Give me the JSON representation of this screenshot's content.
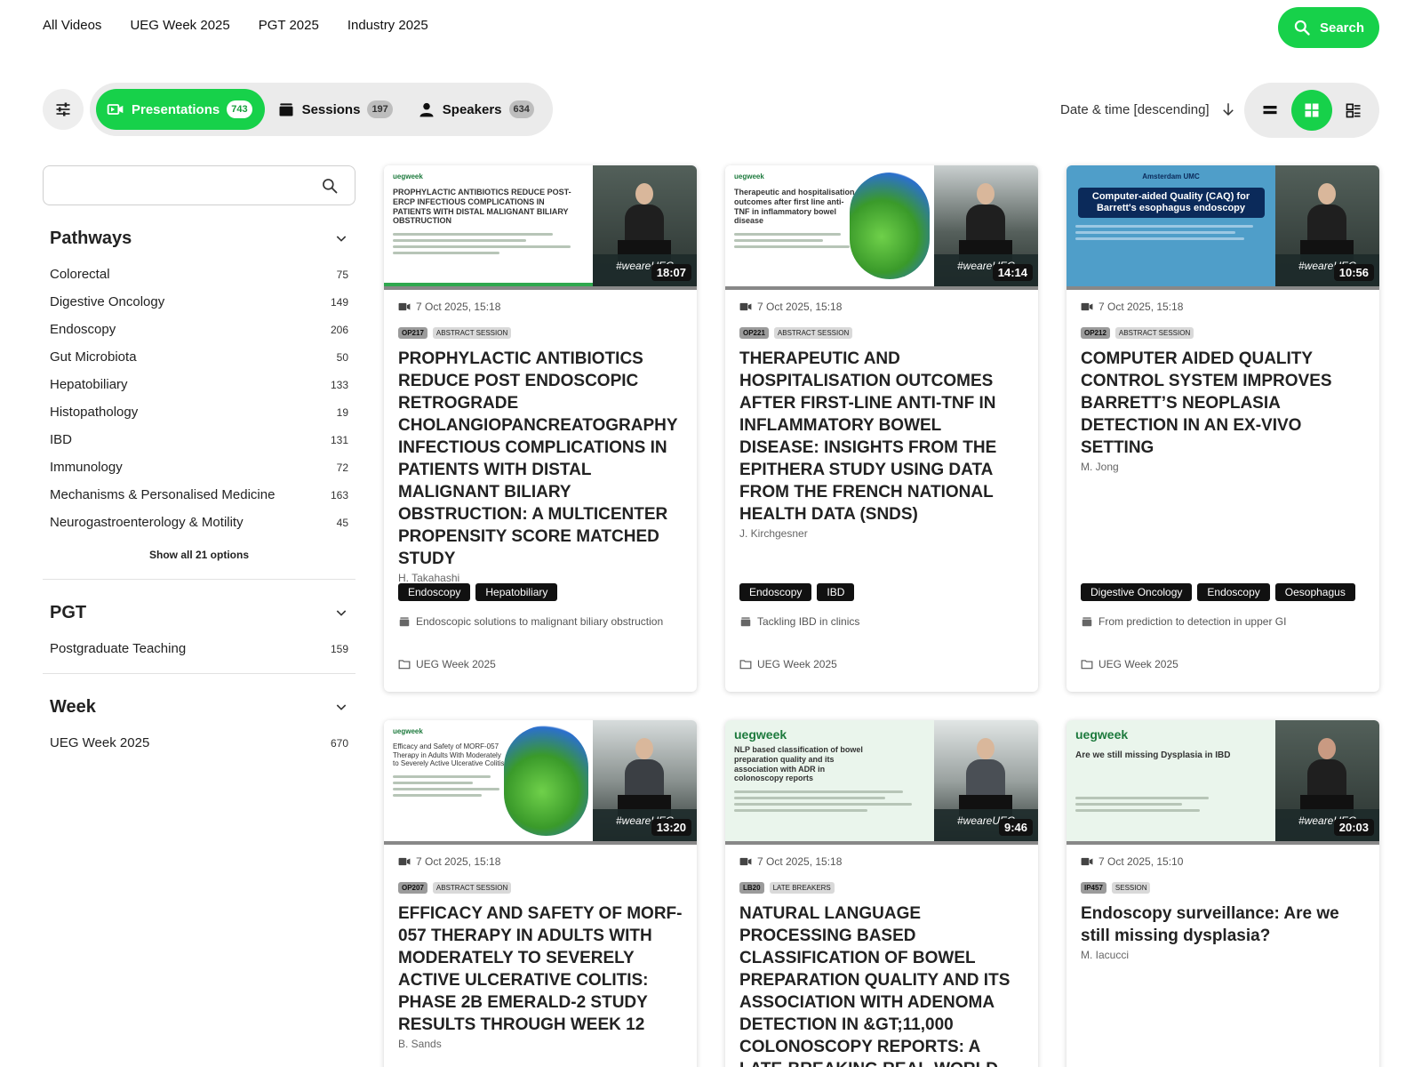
{
  "nav": {
    "links": [
      "All Videos",
      "UEG Week 2025",
      "PGT 2025",
      "Industry 2025"
    ],
    "search_label": "Search"
  },
  "tabs": [
    {
      "label": "Presentations",
      "count": "743",
      "icon": "video-icon"
    },
    {
      "label": "Sessions",
      "count": "197",
      "icon": "briefcase-icon"
    },
    {
      "label": "Speakers",
      "count": "634",
      "icon": "person-icon"
    }
  ],
  "sort": {
    "label": "Date & time [descending]"
  },
  "sidebar": {
    "search_placeholder": "",
    "facets": [
      {
        "title": "Pathways",
        "items": [
          {
            "label": "Colorectal",
            "count": "75"
          },
          {
            "label": "Digestive Oncology",
            "count": "149"
          },
          {
            "label": "Endoscopy",
            "count": "206"
          },
          {
            "label": "Gut Microbiota",
            "count": "50"
          },
          {
            "label": "Hepatobiliary",
            "count": "133"
          },
          {
            "label": "Histopathology",
            "count": "19"
          },
          {
            "label": "IBD",
            "count": "131"
          },
          {
            "label": "Immunology",
            "count": "72"
          },
          {
            "label": "Mechanisms & Personalised Medicine",
            "count": "163"
          },
          {
            "label": "Neurogastroenterology & Motility",
            "count": "45"
          }
        ],
        "show_all": "Show all 21 options"
      },
      {
        "title": "PGT",
        "items": [
          {
            "label": "Postgraduate Teaching",
            "count": "159"
          }
        ]
      },
      {
        "title": "Week",
        "items": [
          {
            "label": "UEG Week 2025",
            "count": "670"
          }
        ]
      }
    ]
  },
  "cards": [
    {
      "duration": "18:07",
      "slide_title": "PROPHYLACTIC ANTIBIOTICS REDUCE POST-ERCP INFECTIOUS COMPLICATIONS IN PATIENTS WITH DISTAL MALIGNANT BILIARY OBSTRUCTION",
      "slide_brand": "uegweek",
      "cam_tag": "#weareUEG",
      "date": "7 Oct 2025, 15:18",
      "code": "OP217",
      "type": "ABSTRACT SESSION",
      "title": "PROPHYLACTIC ANTIBIOTICS REDUCE POST ENDOSCOPIC RETROGRADE CHOLANGIOPANCREATOGRAPHY INFECTIOUS COMPLICATIONS IN PATIENTS WITH DISTAL MALIGNANT BILIARY OBSTRUCTION: A MULTICENTER PROPENSITY SCORE MATCHED STUDY",
      "speaker": "H. Takahashi",
      "topics": [
        "Endoscopy",
        "Hepatobiliary"
      ],
      "session": "Endoscopic solutions to malignant biliary obstruction",
      "event": "UEG Week 2025"
    },
    {
      "duration": "14:14",
      "slide_title": "Therapeutic and hospitalisation outcomes after first line anti-TNF in inflammatory bowel disease",
      "slide_brand": "uegweek",
      "cam_tag": "#weareUEG",
      "date": "7 Oct 2025, 15:18",
      "code": "OP221",
      "type": "ABSTRACT SESSION",
      "title": "THERAPEUTIC AND HOSPITALISATION OUTCOMES AFTER FIRST-LINE ANTI-TNF IN INFLAMMATORY BOWEL DISEASE: INSIGHTS FROM THE EPITHERA STUDY USING DATA FROM THE FRENCH NATIONAL HEALTH DATA (SNDS)",
      "speaker": "J. Kirchgesner",
      "topics": [
        "Endoscopy",
        "IBD"
      ],
      "session": "Tackling IBD in clinics",
      "event": "UEG Week 2025"
    },
    {
      "duration": "10:56",
      "slide_title": "Computer-aided Quality (CAQ) for Barrett's esophagus endoscopy",
      "slide_brand": "Amsterdam UMC",
      "cam_tag": "#weareUEG",
      "date": "7 Oct 2025, 15:18",
      "code": "OP212",
      "type": "ABSTRACT SESSION",
      "title": "COMPUTER AIDED QUALITY CONTROL SYSTEM IMPROVES BARRETT’S NEOPLASIA DETECTION IN AN EX-VIVO SETTING",
      "speaker": "M. Jong",
      "topics": [
        "Digestive Oncology",
        "Endoscopy",
        "Oesophagus"
      ],
      "session": "From prediction to detection in upper GI",
      "event": "UEG Week 2025"
    },
    {
      "duration": "13:20",
      "slide_title": "Efficacy and Safety of MORF-057 Therapy in Adults With Moderately to Severely Active Ulcerative Colitis",
      "slide_brand": "uegweek",
      "cam_tag": "#weareUEG",
      "date": "7 Oct 2025, 15:18",
      "code": "OP207",
      "type": "ABSTRACT SESSION",
      "title": "EFFICACY AND SAFETY OF MORF-057 THERAPY IN ADULTS WITH MODERATELY TO SEVERELY ACTIVE ULCERATIVE COLITIS: PHASE 2B EMERALD-2 STUDY RESULTS THROUGH WEEK 12",
      "speaker": "B. Sands",
      "topics": [],
      "session": "",
      "event": ""
    },
    {
      "duration": "9:46",
      "slide_title": "NLP based classification of bowel preparation quality and its association with ADR in colonoscopy reports",
      "slide_brand": "uegweek",
      "cam_tag": "#weareUEG",
      "date": "7 Oct 2025, 15:18",
      "code": "LB20",
      "type": "LATE BREAKERS",
      "title": "NATURAL LANGUAGE PROCESSING BASED CLASSIFICATION OF BOWEL PREPARATION QUALITY AND ITS ASSOCIATION WITH ADENOMA DETECTION IN &GT;11,000 COLONOSCOPY REPORTS: A LATE-BREAKING REAL-WORLD ANALYSIS",
      "speaker": "",
      "topics": [],
      "session": "",
      "event": ""
    },
    {
      "duration": "20:03",
      "slide_title": "Are we still missing Dysplasia in IBD",
      "slide_brand": "uegweek",
      "cam_tag": "#weareUEG",
      "date": "7 Oct 2025, 15:10",
      "code": "IP457",
      "type": "SESSION",
      "title": "Endoscopy surveillance: Are we still missing dysplasia?",
      "speaker": "M. Iacucci",
      "topics": [],
      "session": "",
      "event": ""
    }
  ],
  "colors": {
    "accent": "#17d14a",
    "slide_bg": "#eaf5ec",
    "slide_green": "#1d7a3d"
  }
}
